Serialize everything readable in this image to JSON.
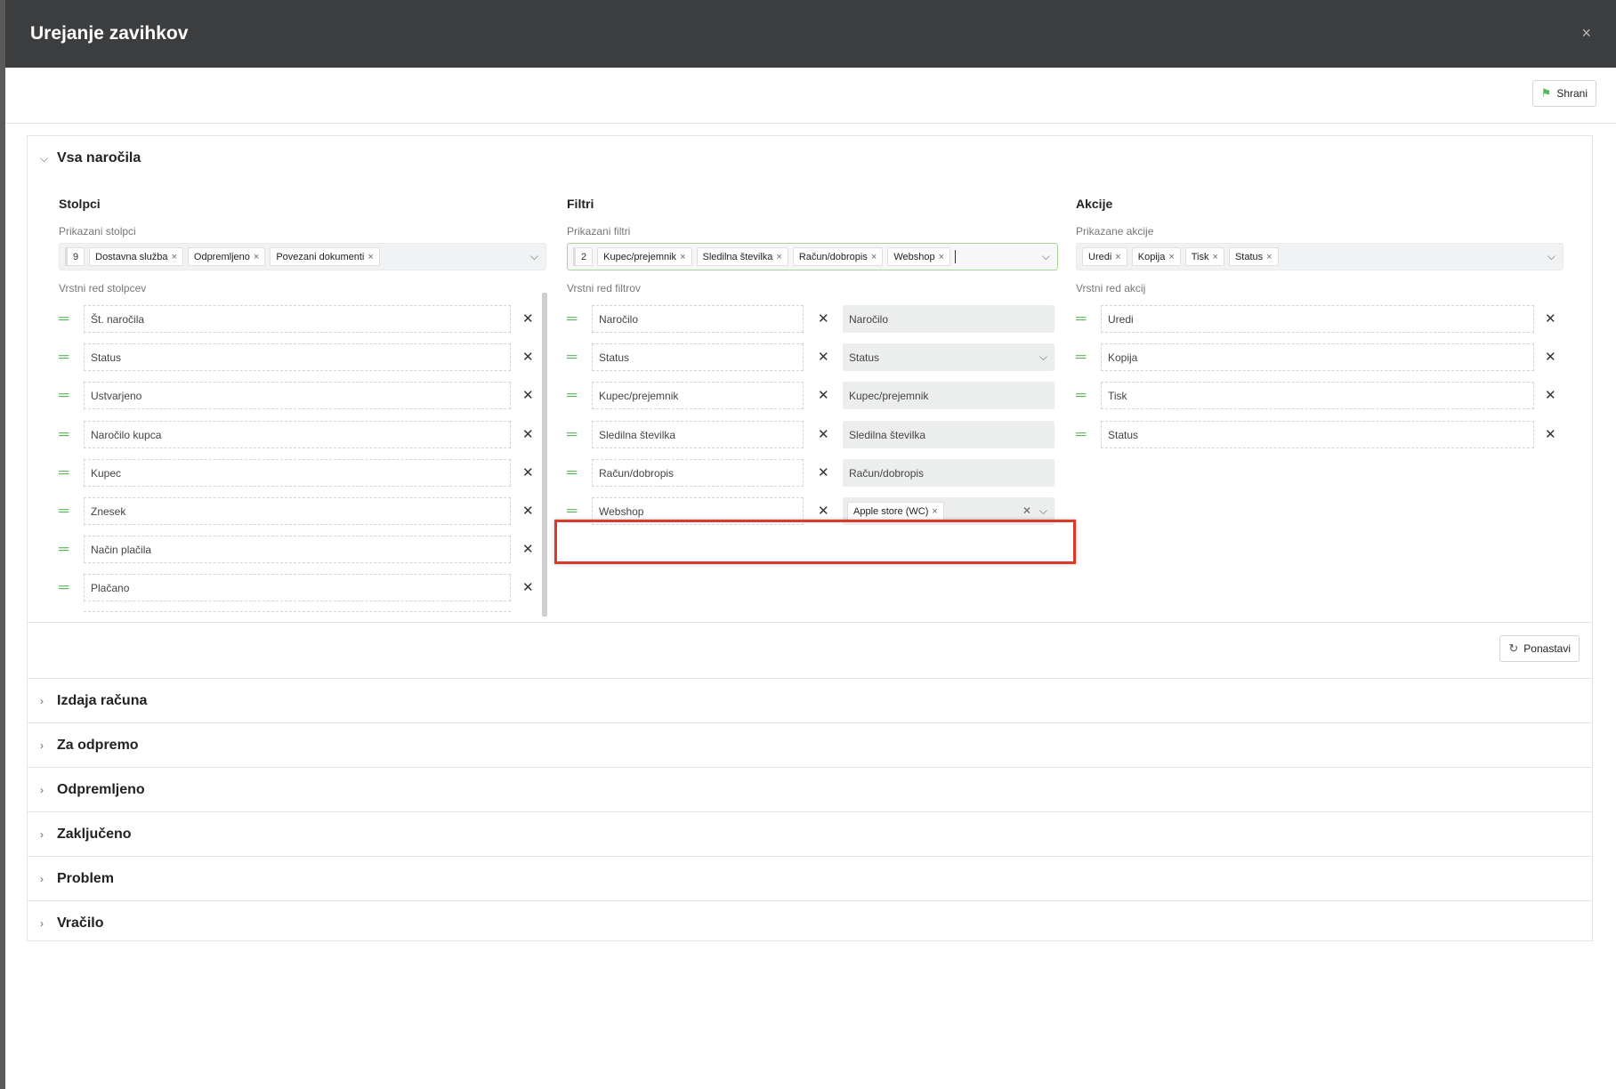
{
  "modal": {
    "title": "Urejanje zavihkov",
    "close_icon": "×"
  },
  "toolbar": {
    "save_label": "Shrani"
  },
  "open_panel": {
    "title": "Vsa naročila",
    "columns": {
      "heading": "Stolpci",
      "shown_label": "Prikazani stolpci",
      "shown_count": "9",
      "shown_tags": [
        "Dostavna služba",
        "Odpremljeno",
        "Povezani dokumenti"
      ],
      "order_label": "Vrstni red stolpcev",
      "items": [
        "Št. naročila",
        "Status",
        "Ustvarjeno",
        "Naročilo kupca",
        "Kupec",
        "Znesek",
        "Način plačila",
        "Plačano"
      ]
    },
    "filters": {
      "heading": "Filtri",
      "shown_label": "Prikazani filtri",
      "shown_count": "2",
      "shown_tags": [
        "Kupec/prejemnik",
        "Sledilna številka",
        "Račun/dobropis",
        "Webshop"
      ],
      "order_label": "Vrstni red filtrov",
      "items": [
        {
          "name": "Naročilo",
          "value": "Naročilo"
        },
        {
          "name": "Status",
          "value": "Status"
        },
        {
          "name": "Kupec/prejemnik",
          "value": "Kupec/prejemnik"
        },
        {
          "name": "Sledilna številka",
          "value": "Sledilna številka"
        },
        {
          "name": "Račun/dobropis",
          "value": "Račun/dobropis"
        },
        {
          "name": "Webshop",
          "value_tag": "Apple store (WC)"
        }
      ]
    },
    "actions": {
      "heading": "Akcije",
      "shown_label": "Prikazane akcije",
      "shown_tags": [
        "Uredi",
        "Kopija",
        "Tisk",
        "Status"
      ],
      "order_label": "Vrstni red akcij",
      "items": [
        "Uredi",
        "Kopija",
        "Tisk",
        "Status"
      ]
    },
    "reset_label": "Ponastavi"
  },
  "collapsed_panels": [
    "Izdaja računa",
    "Za odpremo",
    "Odpremljeno",
    "Zaključeno",
    "Problem",
    "Vračilo"
  ],
  "colors": {
    "header": "#3c3d3f",
    "accent_green": "#5ab55a",
    "highlight_red": "#d83a2c"
  }
}
